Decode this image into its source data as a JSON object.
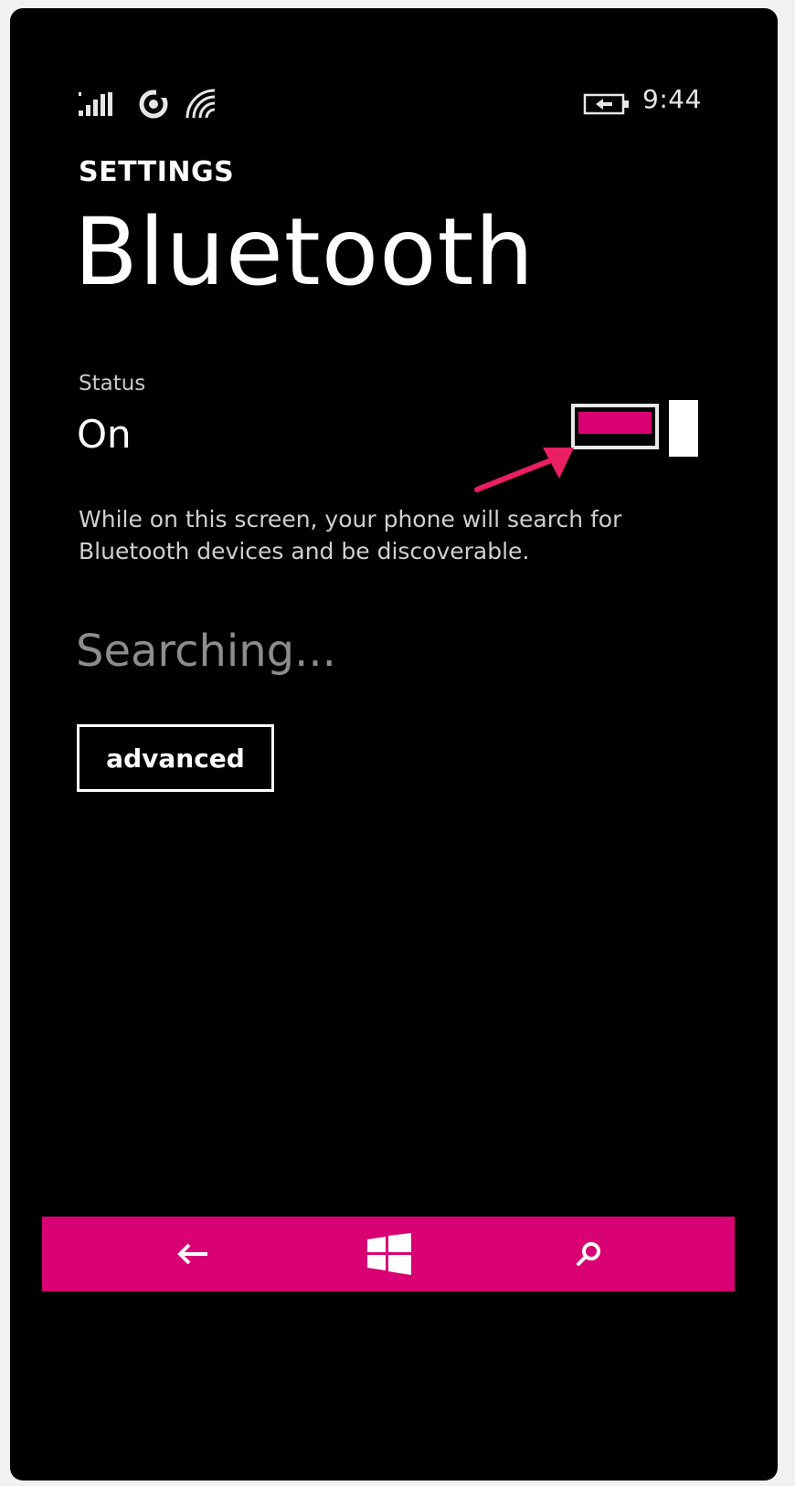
{
  "status_bar": {
    "time": "9:44",
    "icons": [
      "signal-icon",
      "sync-icon",
      "wifi-icon",
      "battery-charging-icon"
    ]
  },
  "header": {
    "app_label": "SETTINGS",
    "page_title": "Bluetooth"
  },
  "bluetooth": {
    "status_caption": "Status",
    "status_value": "On",
    "toggle_on": true,
    "description": "While on this screen, your phone will search for Bluetooth devices and be discoverable.",
    "searching_text": "Searching...",
    "advanced_label": "advanced"
  },
  "nav": {
    "buttons": [
      "back-arrow-icon",
      "windows-start-icon",
      "search-icon"
    ]
  },
  "colors": {
    "accent": "#d80073",
    "background": "#000000",
    "text": "#ffffff",
    "annotation_arrow": "#e91e63"
  }
}
